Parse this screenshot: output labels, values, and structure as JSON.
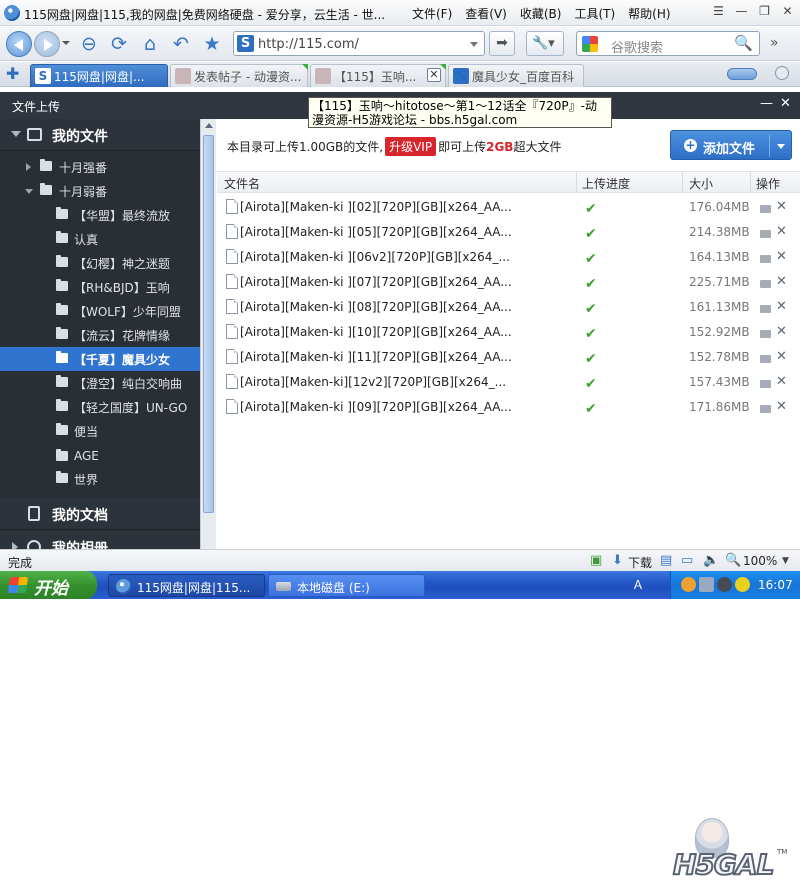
{
  "browser": {
    "title": "115网盘|网盘|115,我的网盘|免费网络硬盘 - 爱分享，云生活 - 世...",
    "menu": [
      "文件(F)",
      "查看(V)",
      "收藏(B)",
      "工具(T)",
      "帮助(H)"
    ],
    "url": "http://115.com/",
    "search_placeholder": "谷歌搜索",
    "tabs": [
      {
        "label": "115网盘|网盘|...",
        "active": true
      },
      {
        "label": "发表帖子 - 动漫资...",
        "active": false
      },
      {
        "label": "【115】玉响...",
        "active": false
      },
      {
        "label": "魔具少女_百度百科",
        "active": false
      }
    ]
  },
  "tooltip": "【115】玉响～hitotose～第1～12话全『720P』-动漫资源-H5游戏论坛 - bbs.h5gal.com",
  "app": {
    "header_title": "文件上传",
    "notice": {
      "prefix": "本目录可上传1.00GB的文件,",
      "vip": "升级VIP",
      "middle": "即可上传",
      "limit": "2GB",
      "suffix": "超大文件"
    },
    "add_button": "添加文件",
    "columns": {
      "name": "文件名",
      "progress": "上传进度",
      "size": "大小",
      "actions": "操作"
    },
    "files": [
      {
        "name": "[Airota][Maken-ki ][02][720P][GB][x264_AA...",
        "size": "176.04MB"
      },
      {
        "name": "[Airota][Maken-ki ][05][720P][GB][x264_AA...",
        "size": "214.38MB"
      },
      {
        "name": "[Airota][Maken-ki ][06v2][720P][GB][x264_...",
        "size": "164.13MB"
      },
      {
        "name": "[Airota][Maken-ki ][07][720P][GB][x264_AA...",
        "size": "225.71MB"
      },
      {
        "name": "[Airota][Maken-ki ][08][720P][GB][x264_AA...",
        "size": "161.13MB"
      },
      {
        "name": "[Airota][Maken-ki ][10][720P][GB][x264_AA...",
        "size": "152.92MB"
      },
      {
        "name": "[Airota][Maken-ki ][11][720P][GB][x264_AA...",
        "size": "152.78MB"
      },
      {
        "name": "[Airota][Maken-ki][12v2][720P][GB][x264_...",
        "size": "157.43MB"
      },
      {
        "name": "[Airota][Maken-ki ][09][720P][GB][x264_AA...",
        "size": "171.86MB"
      }
    ]
  },
  "sidebar": {
    "section_files": "我的文件",
    "items": [
      {
        "label": "十月强番",
        "level": 1,
        "expanded": false
      },
      {
        "label": "十月弱番",
        "level": 1,
        "expanded": true
      },
      {
        "label": "【华盟】最终流放",
        "level": 2
      },
      {
        "label": "认真",
        "level": 2
      },
      {
        "label": "【幻樱】神之迷题",
        "level": 2
      },
      {
        "label": "【RH&BJD】玉响",
        "level": 2
      },
      {
        "label": "【WOLF】少年同盟",
        "level": 2
      },
      {
        "label": "【流云】花牌情缘",
        "level": 2
      },
      {
        "label": "【千夏】魔具少女",
        "level": 2,
        "active": true
      },
      {
        "label": "【澄空】纯白交响曲",
        "level": 2
      },
      {
        "label": "【轻之国度】UN-GO",
        "level": 2
      },
      {
        "label": "便当",
        "level": 2
      },
      {
        "label": "AGE",
        "level": 2
      },
      {
        "label": "世界",
        "level": 2
      }
    ],
    "section_docs": "我的文档",
    "section_album": "我的相册"
  },
  "statusbar": {
    "status": "完成",
    "download": "下载",
    "zoom": "100%"
  },
  "taskbar": {
    "start": "开始",
    "tasks": [
      "115网盘|网盘|115...",
      "本地磁盘 (E:)"
    ],
    "ime": "Ａ",
    "clock": "16:07"
  },
  "watermark": {
    "text": "H5GAL",
    "tm": "TM"
  }
}
